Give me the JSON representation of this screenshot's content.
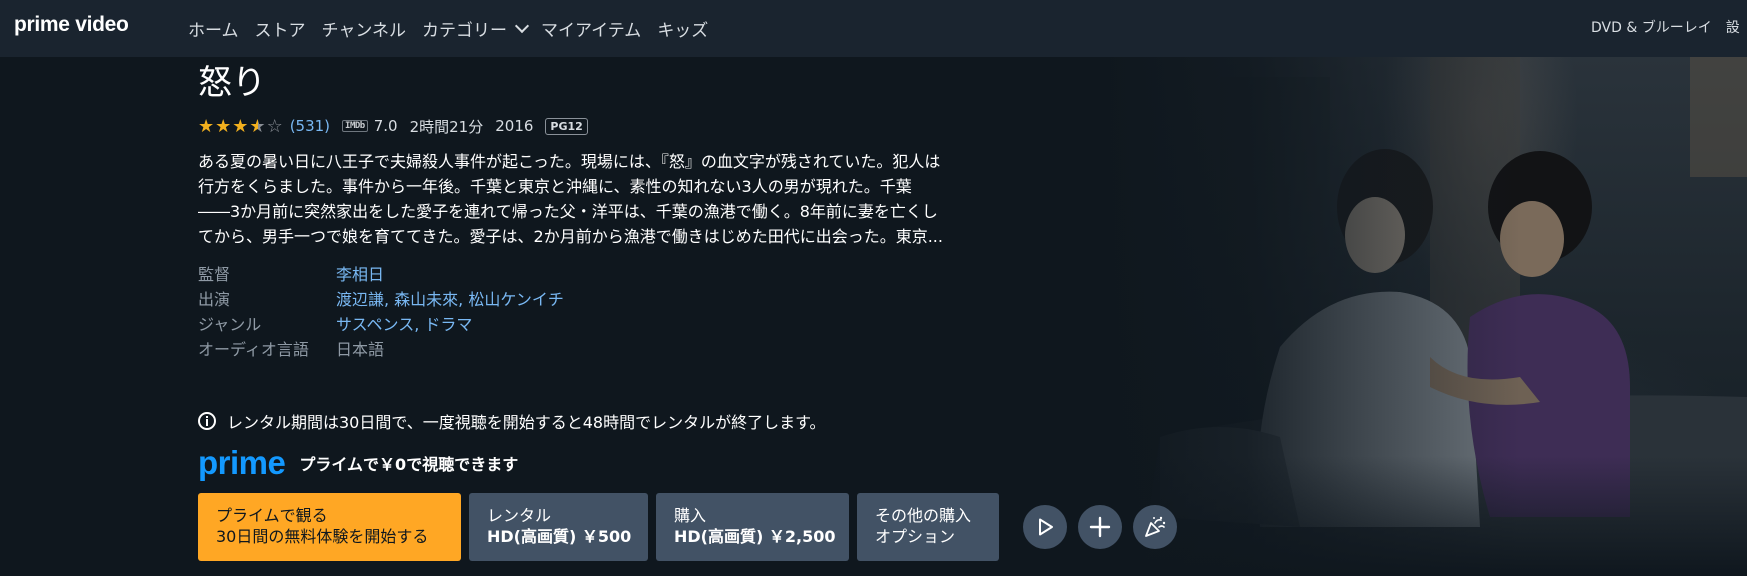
{
  "nav": {
    "logo": "prime video",
    "items": [
      "ホーム",
      "ストア",
      "チャンネル",
      "カテゴリー",
      "マイアイテム",
      "キッズ"
    ],
    "right_item": "DVD & ブルーレイ　設"
  },
  "title": "怒り",
  "meta": {
    "rating_stars": 3.5,
    "rating_count": "(531)",
    "imdb_label": "IMDb",
    "imdb_score": "7.0",
    "duration": "2時間21分",
    "year": "2016",
    "age_badge": "PG12"
  },
  "synopsis_lines": [
    "ある夏の暑い日に八王子で夫婦殺人事件が起こった。現場には、『怒』の血文字が残されていた。犯人は",
    "行方をくらました。事件から一年後。千葉と東京と沖縄に、素性の知れない3人の男が現れた。千葉",
    "――3か月前に突然家出をした愛子を連れて帰った父・洋平は、千葉の漁港で働く。8年前に妻を亡くし",
    "てから、男手一つで娘を育ててきた。愛子は、2か月前から漁港で働きはじめた田代に出会った。東京..."
  ],
  "details": {
    "director_label": "監督",
    "director": "李相日",
    "cast_label": "出演",
    "cast": "渡辺謙, 森山未來, 松山ケンイチ",
    "genre_label": "ジャンル",
    "genre": "サスペンス, ドラマ",
    "audio_label": "オーディオ言語",
    "audio": "日本語"
  },
  "notice": "レンタル期間は30日間で、一度視聴を開始すると48時間でレンタルが終了します。",
  "prime": {
    "logo_text": "prime",
    "message": "プライムで￥0で視聴できます"
  },
  "buttons": {
    "primary_line1": "プライムで観る",
    "primary_line2": "30日間の無料体験を開始する",
    "rent_line1": "レンタル",
    "rent_line2": "HD(高画質) ￥500",
    "buy_line1": "購入",
    "buy_line2": "HD(高画質) ￥2,500",
    "other_line1": "その他の購入",
    "other_line2": "オプション"
  },
  "icons": {
    "play": "play-icon",
    "add": "plus-icon",
    "watch_party": "watch-party-icon",
    "info": "info-icon"
  },
  "colors": {
    "background": "#0f171e",
    "nav": "#1a242f",
    "accent_blue": "#1399ff",
    "link": "#79b8f3",
    "primary_button": "#ffa724",
    "secondary_button": "#425265",
    "star": "#f2b01e"
  }
}
